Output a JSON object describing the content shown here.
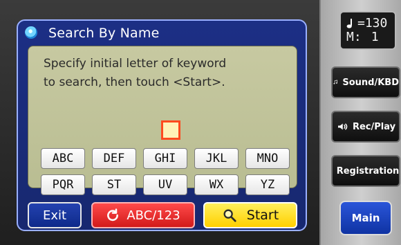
{
  "dialog": {
    "icon": "cd-icon",
    "title": "Search By Name",
    "instruction": "Specify initial letter of keyword\nto search, then touch <Start>."
  },
  "keypad": {
    "rows": [
      [
        "ABC",
        "DEF",
        "GHI",
        "JKL",
        "MNO"
      ],
      [
        "PQR",
        "ST",
        "UV",
        "WX",
        "YZ"
      ]
    ]
  },
  "buttons": {
    "exit": "Exit",
    "abc_toggle": "ABC/123",
    "start": "Start"
  },
  "sidebar": {
    "tempo": {
      "note": "quarter-note",
      "bpm": "=130",
      "measure_label": "M:",
      "measure_value": "1"
    },
    "items": [
      {
        "label": "Sound/KBD",
        "icon": "music-note-icon"
      },
      {
        "label": "Rec/Play",
        "icon": "speaker-icon"
      },
      {
        "label": "Registration",
        "icon": "book-icon"
      }
    ],
    "main": "Main"
  },
  "colors": {
    "dialog_blue": "#1c2f85",
    "panel_khaki": "#c7c9a1",
    "abc_red": "#d21a1a",
    "start_yellow": "#ffd000",
    "main_blue": "#0f33a3"
  }
}
